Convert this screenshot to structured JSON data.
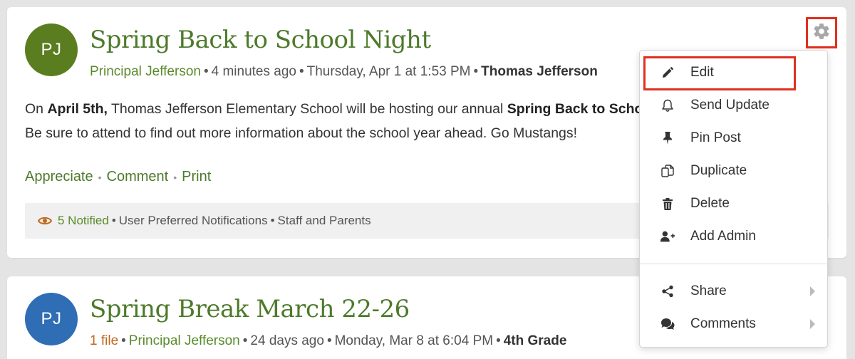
{
  "colors": {
    "green_title": "#4d7a2b",
    "green_link": "#5a8a2a",
    "avatar_green": "#5a7d1f",
    "avatar_blue": "#2f6db5",
    "highlight_red": "#e0301e",
    "file_orange": "#c0681f"
  },
  "posts": [
    {
      "avatar_initials": "PJ",
      "title": "Spring Back to School Night",
      "author": "Principal Jefferson",
      "relative_time": "4 minutes ago",
      "timestamp": "Thursday, Apr 1 at 1:53 PM",
      "audience": "Thomas Jefferson",
      "body": {
        "p1_a": "On ",
        "p1_b": "April 5th,",
        "p1_c": " Thomas Jefferson Elementary School will be hosting our annual ",
        "p1_d": "Spring Back to School Night",
        "p2": "Be sure to attend to find out more information about the school year ahead. Go Mustangs!"
      },
      "actions": [
        "Appreciate",
        "Comment",
        "Print"
      ],
      "notify": {
        "count": "5 Notified",
        "method": "User Preferred Notifications",
        "recipients": "Staff and Parents"
      }
    },
    {
      "avatar_initials": "PJ",
      "title": "Spring Break March 22-26",
      "files": "1 file",
      "author": "Principal Jefferson",
      "relative_time": "24 days ago",
      "timestamp": "Monday, Mar 8 at 6:04 PM",
      "audience": "4th Grade"
    }
  ],
  "menu": {
    "items": [
      {
        "label": "Edit",
        "icon": "pencil-icon"
      },
      {
        "label": "Send Update",
        "icon": "bell-icon"
      },
      {
        "label": "Pin Post",
        "icon": "pin-icon"
      },
      {
        "label": "Duplicate",
        "icon": "copy-icon"
      },
      {
        "label": "Delete",
        "icon": "trash-icon"
      },
      {
        "label": "Add Admin",
        "icon": "user-plus-icon"
      },
      {
        "label": "Share",
        "icon": "share-icon"
      },
      {
        "label": "Comments",
        "icon": "comments-icon"
      }
    ]
  }
}
